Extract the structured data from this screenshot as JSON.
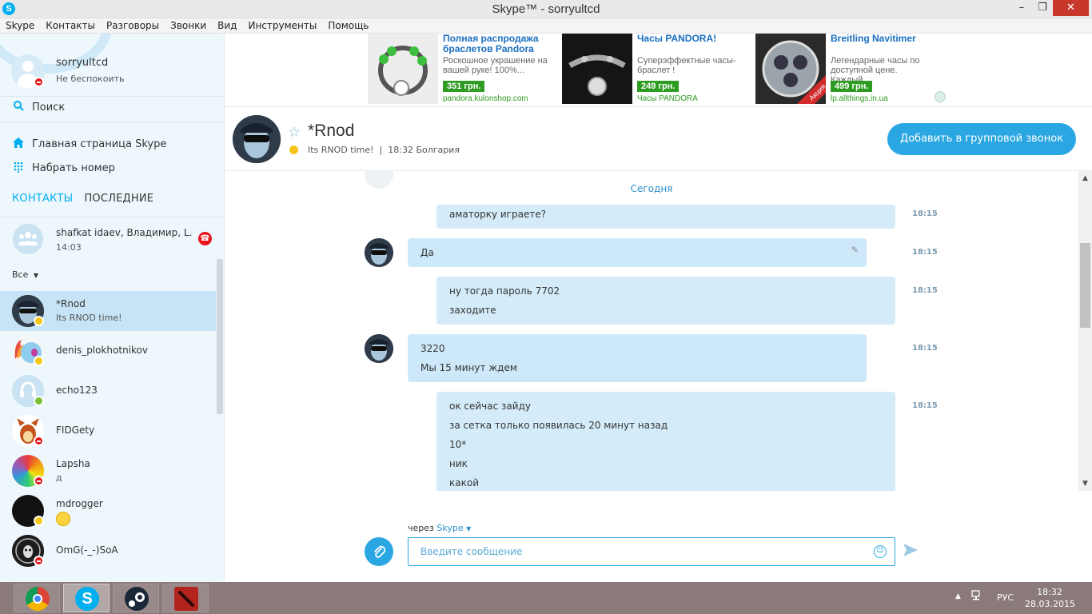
{
  "window": {
    "title": "Skype™ - sorryultcd",
    "app_icon": "S",
    "min_icon": "minimize-icon",
    "max_icon": "maximize-icon",
    "close_icon": "close-icon",
    "min_glyph": "–",
    "max_glyph": "❐",
    "close_glyph": "✕"
  },
  "menu": [
    "Skype",
    "Контакты",
    "Разговоры",
    "Звонки",
    "Вид",
    "Инструменты",
    "Помощь"
  ],
  "profile": {
    "name": "sorryultcd",
    "status": "Не беспокоить"
  },
  "nav": {
    "search": "Поиск",
    "home": "Главная страница Skype",
    "dial": "Набрать номер"
  },
  "tabs": {
    "contacts": "КОНТАКТЫ",
    "recent": "ПОСЛЕДНИЕ"
  },
  "group_call": {
    "name": "shafkat idaev, Владимир, L...",
    "time": "14:03"
  },
  "filter": "Все",
  "contacts": [
    {
      "name": "*Rnod",
      "mood": "Its RNOD time!",
      "status": "away"
    },
    {
      "name": "denis_plokhotnikov",
      "mood": "",
      "status": "away"
    },
    {
      "name": "echo123",
      "mood": "",
      "status": "online"
    },
    {
      "name": "FIDGety",
      "mood": "",
      "status": "dnd"
    },
    {
      "name": "Lapsha",
      "mood": "д",
      "status": "dnd"
    },
    {
      "name": "mdrogger",
      "mood": "",
      "status": "away"
    },
    {
      "name": "OmG(-_-)SoA",
      "mood": "",
      "status": "dnd"
    }
  ],
  "ads": [
    {
      "title": "Полная распродажа браслетов Pandora",
      "desc": "Роскошное украшение на вашей руке! 100%...",
      "price": "351 грн.",
      "url": "pandora.kulonshop.com"
    },
    {
      "title": "Часы PANDORA!",
      "desc": "Суперэффектные часы-браслет !",
      "price": "249 грн.",
      "url": "Часы PANDORA"
    },
    {
      "title": "Breitling Navitimer",
      "desc": "Легендарные часы по доступной цене. Каждый...",
      "price": "499 грн.",
      "url": "lp.allthings.in.ua",
      "badge": "Акция"
    }
  ],
  "conversation": {
    "name": "*Rnod",
    "mood": "Its RNOD time!",
    "local_time": "18:32 Болгария",
    "add_to_call": "Добавить в групповой звонок"
  },
  "messages": {
    "date": "Сегодня",
    "items": [
      {
        "dir": "out",
        "time": "18:15",
        "lines": [
          "аматорку играете?"
        ]
      },
      {
        "dir": "in",
        "time": "18:15",
        "lines": [
          "Да"
        ],
        "edited": true
      },
      {
        "dir": "out",
        "time": "18:15",
        "lines": [
          "ну тогда пароль 7702",
          "заходите"
        ]
      },
      {
        "dir": "in",
        "time": "18:15",
        "lines": [
          "3220",
          "Мы 15 минут ждем"
        ]
      },
      {
        "dir": "out",
        "time": "18:15",
        "lines": [
          "ок сейчас зайду",
          "за сетка только появилась 20 минут назад",
          "10*",
          "ник",
          "какой"
        ]
      }
    ]
  },
  "composer": {
    "via_label": "через",
    "via_service": "Skype",
    "placeholder": "Введите сообщение"
  },
  "taskbar": {
    "apps": [
      "chrome",
      "skype",
      "steam",
      "dota"
    ],
    "language": "РУС",
    "time": "18:32",
    "date": "28.03.2015"
  }
}
